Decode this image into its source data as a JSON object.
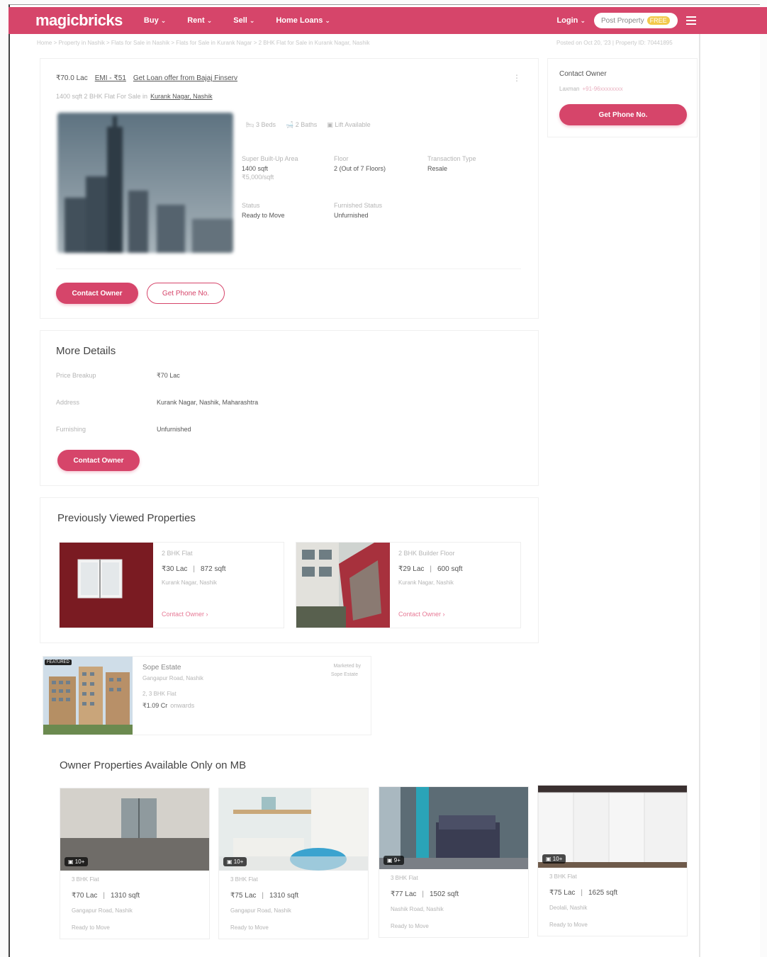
{
  "header": {
    "logo": "magicbricks",
    "nav": [
      "Buy",
      "Rent",
      "Sell",
      "Home Loans"
    ],
    "login": "Login",
    "post_property": "Post Property",
    "post_tag": "FREE"
  },
  "breadcrumb": "Home > Property in Nashik > Flats for Sale in Nashik > Flats for Sale in Kurank Nagar > 2 BHK Flat for Sale in Kurank Nagar, Nashik",
  "breadcrumb_right": "Posted on Oct 20, '23 | Property ID: 70441895",
  "listing": {
    "price": "₹70.0 Lac",
    "emi": "EMI - ₹51",
    "home_loan": "Get Loan offer from Bajaj Finserv",
    "title_prefix": "1400 sqft 2 BHK Flat For Sale in",
    "location_link": "Kurank Nagar, Nashik",
    "stats": [
      "3 Beds",
      "2 Baths",
      "Lift Available"
    ],
    "details": [
      {
        "label": "Super Built-Up Area",
        "value": "1400 sqft",
        "sub": "₹5,000/sqft"
      },
      {
        "label": "Floor",
        "value": "2 (Out of 7 Floors)"
      },
      {
        "label": "Transaction Type",
        "value": "Resale"
      },
      {
        "label": "Status",
        "value": "Ready to Move"
      },
      {
        "label": "Furnished Status",
        "value": "Unfurnished"
      }
    ],
    "contact_btn": "Contact Owner",
    "phone_btn": "Get Phone No."
  },
  "sidebar": {
    "title": "Contact Owner",
    "owner": "Laxman",
    "owner_phone": "+91-96xxxxxxxx",
    "phone_btn": "Get Phone No."
  },
  "more_details": {
    "title": "More Details",
    "rows": [
      {
        "label": "Price Breakup",
        "value": "₹70 Lac"
      },
      {
        "label": "Address",
        "value": "Kurank Nagar, Nashik, Maharashtra"
      },
      {
        "label": "Furnishing",
        "value": "Unfurnished"
      }
    ],
    "contact_btn": "Contact Owner"
  },
  "previous": {
    "title": "Previously Viewed Properties",
    "items": [
      {
        "type": "2 BHK Flat",
        "price": "₹30 Lac",
        "area": "872 sqft",
        "loc": "Kurank Nagar, Nashik",
        "cta": "Contact Owner ›"
      },
      {
        "type": "2 BHK Builder Floor",
        "price": "₹29 Lac",
        "area": "600 sqft",
        "loc": "Kurank Nagar, Nashik",
        "cta": "Contact Owner ›"
      }
    ]
  },
  "promo": {
    "tag": "FEATURED",
    "name": "Sope Estate",
    "loc": "Gangapur Road, Nashik",
    "type": "2, 3 BHK Flat",
    "price": "₹1.09 Cr",
    "price_sub": "onwards",
    "right1": "Marketed by",
    "right2": "Sope Estate"
  },
  "owner_props": {
    "title": "Owner Properties Available Only on MB",
    "items": [
      {
        "photos": "10+",
        "type": "3 BHK Flat",
        "price": "₹70 Lac",
        "area": "1310 sqft",
        "loc": "Gangapur Road, Nashik",
        "status": "Ready to Move"
      },
      {
        "photos": "10+",
        "type": "3 BHK Flat",
        "price": "₹75 Lac",
        "area": "1310 sqft",
        "loc": "Gangapur Road, Nashik",
        "status": "Ready to Move"
      },
      {
        "photos": "9+",
        "type": "3 BHK Flat",
        "price": "₹77 Lac",
        "area": "1502 sqft",
        "loc": "Nashik Road, Nashik",
        "status": "Ready to Move"
      },
      {
        "photos": "10+",
        "type": "3 BHK Flat",
        "price": "₹75 Lac",
        "area": "1625 sqft",
        "loc": "Deolali, Nashik",
        "status": "Ready to Move"
      }
    ]
  },
  "colors": {
    "brand": "#d6456a",
    "free_tag": "#f2c94c"
  }
}
